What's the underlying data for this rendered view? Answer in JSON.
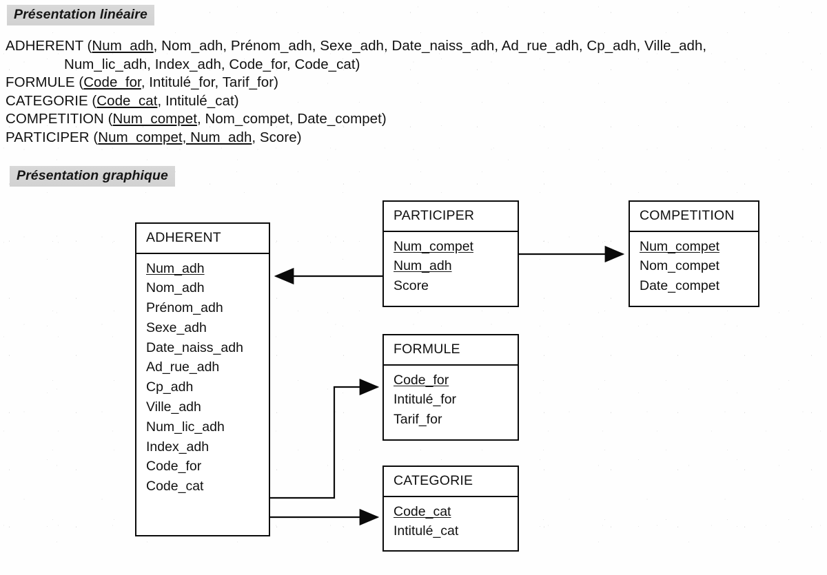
{
  "page": {
    "sections": [
      {
        "id": "lineaire",
        "heading": "Présentation linéaire"
      },
      {
        "id": "graphique",
        "heading": "Présentation graphique"
      }
    ]
  },
  "linear_presentation": {
    "relations": [
      {
        "name": "ADHERENT",
        "line1_key": "Num_adh",
        "line1_rest": ", Nom_adh, Prénom_adh, Sexe_adh, Date_naiss_adh, Ad_rue_adh, Cp_adh, Ville_adh,",
        "line2": "Num_lic_adh, Index_adh, Code_for, Code_cat)"
      },
      {
        "name": "FORMULE",
        "key": "Code_for",
        "rest": ", Intitulé_for, Tarif_for)"
      },
      {
        "name": "CATEGORIE",
        "key": "Code_cat",
        "rest": ", Intitulé_cat)"
      },
      {
        "name": "COMPETITION",
        "key": "Num_compet",
        "rest": ", Nom_compet, Date_compet)"
      },
      {
        "name": "PARTICIPER",
        "key": "Num_compet, Num_adh",
        "rest": ", Score)"
      }
    ],
    "open_paren": " (",
    "close_paren": ")"
  },
  "graphic_presentation": {
    "entities": [
      {
        "id": "adherent",
        "title": "ADHERENT",
        "attributes": [
          {
            "name": "Num_adh",
            "key": true
          },
          {
            "name": "Nom_adh",
            "key": false
          },
          {
            "name": "Prénom_adh",
            "key": false
          },
          {
            "name": "Sexe_adh",
            "key": false
          },
          {
            "name": "Date_naiss_adh",
            "key": false
          },
          {
            "name": "Ad_rue_adh",
            "key": false
          },
          {
            "name": "Cp_adh",
            "key": false
          },
          {
            "name": "Ville_adh",
            "key": false
          },
          {
            "name": "Num_lic_adh",
            "key": false
          },
          {
            "name": "Index_adh",
            "key": false
          },
          {
            "name": "Code_for",
            "key": false
          },
          {
            "name": "Code_cat",
            "key": false
          }
        ]
      },
      {
        "id": "participer",
        "title": "PARTICIPER",
        "attributes": [
          {
            "name": "Num_compet",
            "key": true
          },
          {
            "name": "Num_adh",
            "key": true
          },
          {
            "name": "Score",
            "key": false
          }
        ]
      },
      {
        "id": "competition",
        "title": "COMPETITION",
        "attributes": [
          {
            "name": "Num_compet",
            "key": true
          },
          {
            "name": "Nom_compet",
            "key": false
          },
          {
            "name": "Date_compet",
            "key": false
          }
        ]
      },
      {
        "id": "formule",
        "title": "FORMULE",
        "attributes": [
          {
            "name": "Code_for",
            "key": true
          },
          {
            "name": "Intitulé_for",
            "key": false
          },
          {
            "name": "Tarif_for",
            "key": false
          }
        ]
      },
      {
        "id": "categorie",
        "title": "CATEGORIE",
        "attributes": [
          {
            "name": "Code_cat",
            "key": true
          },
          {
            "name": "Intitulé_cat",
            "key": false
          }
        ]
      }
    ],
    "relationships": [
      {
        "id": "participer-to-adherent",
        "from": "PARTICIPER.Num_adh",
        "to": "ADHERENT.Num_adh"
      },
      {
        "id": "participer-to-competition",
        "from": "PARTICIPER.Num_compet",
        "to": "COMPETITION.Num_compet"
      },
      {
        "id": "adherent-to-formule",
        "from": "ADHERENT.Code_for",
        "to": "FORMULE.Code_for"
      },
      {
        "id": "adherent-to-categorie",
        "from": "ADHERENT.Code_cat",
        "to": "CATEGORIE.Code_cat"
      }
    ]
  },
  "colors": {
    "ink": "#111111",
    "highlight": "#d5d5d5",
    "page": "#fefefe"
  }
}
